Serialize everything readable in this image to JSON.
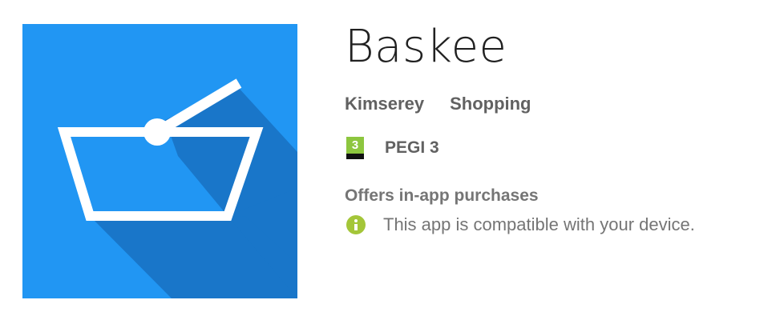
{
  "app": {
    "title": "Baskee",
    "developer": "Kimserey",
    "category": "Shopping",
    "icon": "shopping-basket-icon",
    "icon_background": "#2196f3"
  },
  "rating": {
    "badge_number": "3",
    "label": "PEGI 3",
    "badge_color": "#8dc63f"
  },
  "purchases": {
    "label": "Offers in-app purchases"
  },
  "compatibility": {
    "icon": "info-icon",
    "icon_color": "#a4c639",
    "text": "This app is compatible with your device."
  }
}
